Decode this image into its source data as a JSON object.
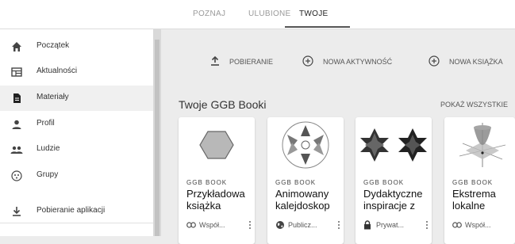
{
  "tabs": [
    {
      "label": "POZNAJ"
    },
    {
      "label": "ULUBIONE"
    },
    {
      "label": "TWOJE"
    }
  ],
  "active_tab": "TWOJE",
  "sidebar": {
    "items": [
      {
        "label": "Początek",
        "icon": "home-icon"
      },
      {
        "label": "Aktualności",
        "icon": "news-icon"
      },
      {
        "label": "Materiały",
        "icon": "document-icon",
        "active": true
      },
      {
        "label": "Profil",
        "icon": "person-icon"
      },
      {
        "label": "Ludzie",
        "icon": "people-icon"
      },
      {
        "label": "Grupy",
        "icon": "groups-icon"
      },
      {
        "label": "Pobieranie aplikacji",
        "icon": "download-icon"
      }
    ]
  },
  "actions": [
    {
      "label": "POBIERANIE",
      "icon": "upload-icon"
    },
    {
      "label": "NOWA AKTYWNOŚĆ",
      "icon": "add-circle-icon"
    },
    {
      "label": "NOWA KSIĄŻKA",
      "icon": "add-circle-icon"
    }
  ],
  "section": {
    "title": "Twoje GGB Booki",
    "show_all": "POKAŻ WSZYSTKIE"
  },
  "cards": [
    {
      "type": "GGB BOOK",
      "title_line1": "Przykładowa",
      "title_line2": "książka",
      "visibility": "Współ...",
      "visibility_icon": "link-icon",
      "thumb": "hexagon"
    },
    {
      "type": "GGB BOOK",
      "title_line1": "Animowany",
      "title_line2": "kalejdoskop",
      "visibility": "Publicz...",
      "visibility_icon": "globe-icon",
      "thumb": "kaleidoscope"
    },
    {
      "type": "GGB BOOK",
      "title_line1": "Dydaktyczne",
      "title_line2": "inspiracje z",
      "visibility": "Prywat...",
      "visibility_icon": "lock-icon",
      "thumb": "stars"
    },
    {
      "type": "GGB BOOK",
      "title_line1": "Ekstrema",
      "title_line2": "lokalne",
      "visibility": "Współ...",
      "visibility_icon": "link-icon",
      "thumb": "paraboloid"
    }
  ],
  "colors": {
    "background": "#ececec",
    "sidebar_active": "#f0f0f0",
    "text": "#333333"
  }
}
